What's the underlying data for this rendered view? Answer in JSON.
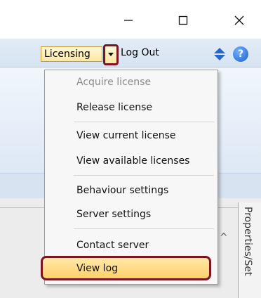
{
  "window": {
    "controls": {
      "minimize_icon": "minimize-icon",
      "maximize_icon": "maximize-icon",
      "close_icon": "close-icon"
    }
  },
  "toolbar": {
    "licensing_label": "Licensing",
    "logout_label": "Log Out",
    "highlight_color": "#7b1523"
  },
  "menu": {
    "items": [
      {
        "label": "Acquire license",
        "disabled": true
      },
      {
        "label": "Release license",
        "disabled": false
      },
      {
        "label": "View current license",
        "disabled": false
      },
      {
        "label": "View available licenses",
        "disabled": false
      },
      {
        "label": "Behaviour settings",
        "disabled": false
      },
      {
        "label": "Server settings",
        "disabled": false
      },
      {
        "label": "Contact server",
        "disabled": false
      },
      {
        "label": "View log",
        "disabled": false,
        "highlighted": true
      }
    ]
  },
  "side_panel": {
    "tab_label": "Properties/Set"
  }
}
